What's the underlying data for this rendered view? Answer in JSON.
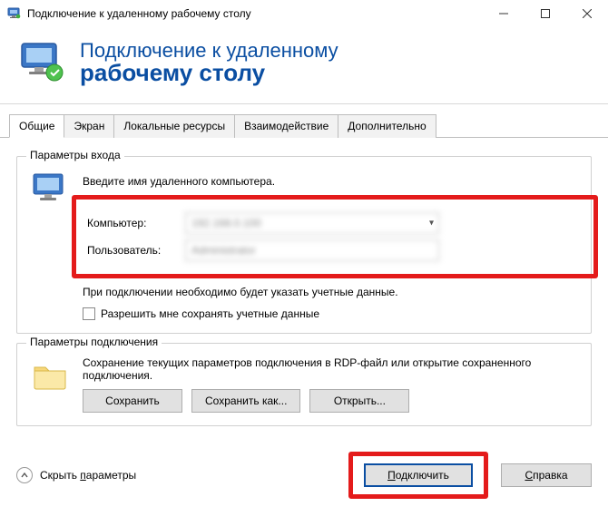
{
  "window": {
    "title": "Подключение к удаленному рабочему столу"
  },
  "header": {
    "line1": "Подключение к удаленному",
    "line2": "рабочему столу"
  },
  "tabs": {
    "items": [
      {
        "label": "Общие"
      },
      {
        "label": "Экран"
      },
      {
        "label": "Локальные ресурсы"
      },
      {
        "label": "Взаимодействие"
      },
      {
        "label": "Дополнительно"
      }
    ],
    "active_index": 0
  },
  "login_group": {
    "title": "Параметры входа",
    "instruction": "Введите имя удаленного компьютера.",
    "computer_label": "Компьютер:",
    "computer_value": "192.168.0.100",
    "user_label": "Пользователь:",
    "user_value": "Administrator",
    "hint": "При подключении необходимо будет указать учетные данные.",
    "save_creds_label": "Разрешить мне сохранять учетные данные"
  },
  "connection_group": {
    "title": "Параметры подключения",
    "desc": "Сохранение текущих параметров подключения в RDP-файл или открытие сохраненного подключения.",
    "save": "Сохранить",
    "save_as": "Сохранить как...",
    "open": "Открыть..."
  },
  "footer": {
    "hide_params_prefix": "Скрыть ",
    "hide_params_underlined": "п",
    "hide_params_suffix": "араметры",
    "connect_prefix": "",
    "connect_underlined": "П",
    "connect_suffix": "одключить",
    "help_prefix": "",
    "help_underlined": "С",
    "help_suffix": "правка"
  }
}
